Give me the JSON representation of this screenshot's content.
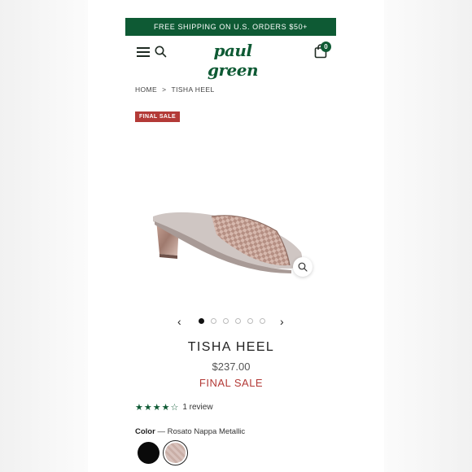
{
  "promo_bar": {
    "text": "FREE SHIPPING ON U.S. ORDERS $50+"
  },
  "header": {
    "logo": "paul green",
    "cart_count": "0"
  },
  "breadcrumb": {
    "home": "HOME",
    "separator": ">",
    "current": "TISHA HEEL"
  },
  "badge": {
    "label": "FINAL SALE"
  },
  "product": {
    "title": "TISHA HEEL",
    "price": "$237.00",
    "sale_note": "FINAL SALE",
    "image_alt": "metallic rose-gold woven slide heel"
  },
  "carousel": {
    "slide_count": 6,
    "active_index": 0
  },
  "reviews": {
    "stars": "★★★★☆",
    "rating": 4,
    "count_text": "1 review"
  },
  "color": {
    "label": "Color",
    "separator": " — ",
    "selected_name": "Rosato Nappa Metallic",
    "swatches": [
      "black",
      "rosato-nappa-metallic"
    ]
  },
  "colors": {
    "brand_green": "#0e5a34",
    "sale_red": "#b33a37"
  }
}
